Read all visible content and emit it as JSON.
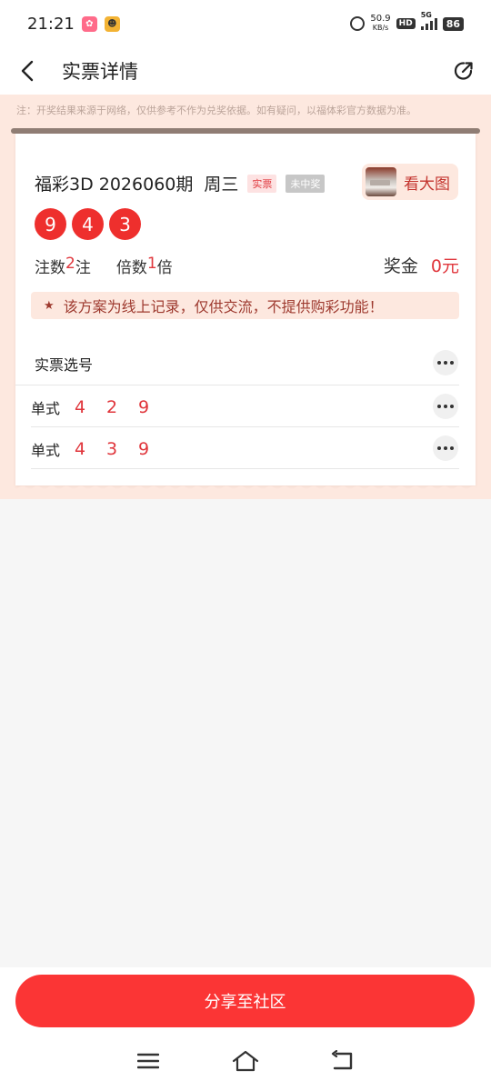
{
  "status_bar": {
    "time": "21:21",
    "net_speed": "50.9",
    "net_speed_unit": "KB/s",
    "hd": "HD",
    "network": "5G",
    "battery": "86"
  },
  "header": {
    "title": "实票详情"
  },
  "notice": "注：开奖结果来源于网络，仅供参考不作为兑奖依据。如有疑问，以福体彩官方数据为准。",
  "ticket": {
    "lottery_name": "福彩3D 2026060期",
    "weekday": "周三",
    "tag_real": "实票",
    "tag_status": "未中奖",
    "big_picture_label": "看大图",
    "balls": [
      "9",
      "4",
      "3"
    ],
    "bets_label": "注数",
    "bets_value": "2",
    "bets_unit": "注",
    "multiple_label": "倍数",
    "multiple_value": "1",
    "multiple_unit": "倍",
    "prize_label": "奖金",
    "prize_value": "0元",
    "disclaimer": "该方案为线上记录，仅供交流，不提供购彩功能！"
  },
  "picks": {
    "section_title": "实票选号",
    "rows": [
      {
        "type": "单式",
        "numbers": [
          "4",
          "2",
          "9"
        ]
      },
      {
        "type": "单式",
        "numbers": [
          "4",
          "3",
          "9"
        ]
      }
    ]
  },
  "footer": {
    "share_button": "分享至社区"
  },
  "colors": {
    "accent_red": "#fb3535",
    "ball_red": "#ee2f2d",
    "peach": "#fde8df"
  }
}
